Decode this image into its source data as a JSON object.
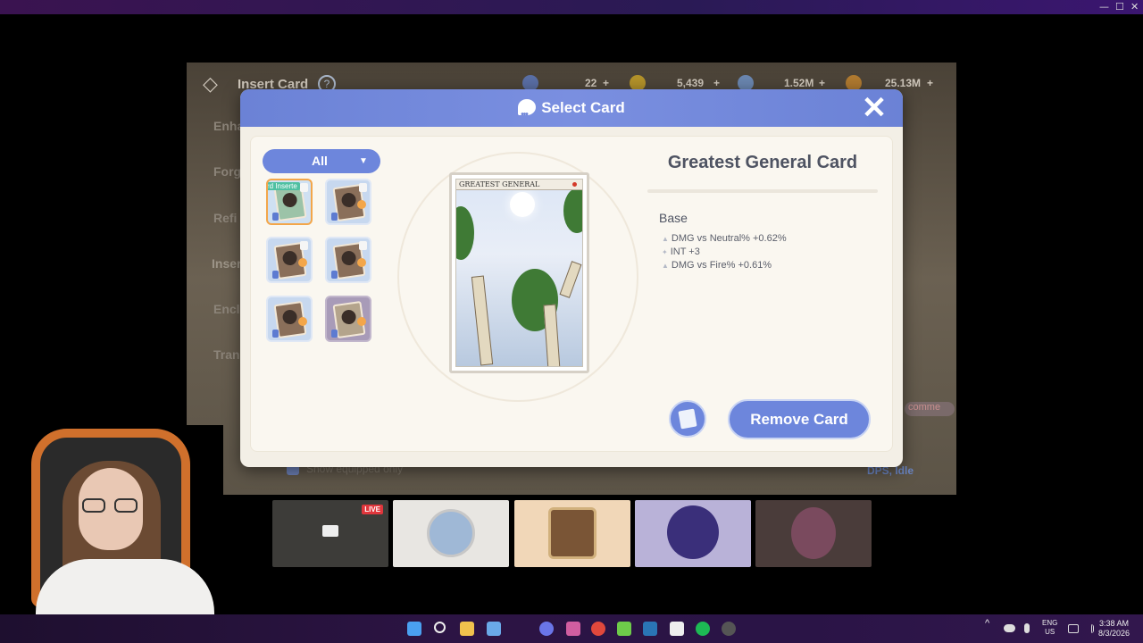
{
  "window_controls": {
    "minimize": "—",
    "maximize": "☐",
    "close": "✕"
  },
  "game": {
    "title": "Insert Card",
    "help": "?",
    "resources": [
      {
        "value": "22",
        "plus": "+",
        "color": "#5a6fa6"
      },
      {
        "value": "5,439",
        "plus": "+",
        "color": "#b3922a"
      },
      {
        "value": "1.52M",
        "plus": "+",
        "color": "#6a86b0"
      },
      {
        "value": "25.13M",
        "plus": "+",
        "color": "#b07a30"
      }
    ],
    "sidebar": [
      "Enha",
      "Forg",
      "Refi",
      "Insert",
      "Encl",
      "Tran"
    ],
    "show_equipped": "Show equipped only",
    "dps_label": "DPS, Idle",
    "comment_tag": "comme"
  },
  "modal": {
    "title": "Select Card",
    "close_label": "✕",
    "filter": {
      "selected": "All",
      "arrow": "▼"
    },
    "inserted_tag": "rd Inserte",
    "slots": [
      {
        "state": "inserted"
      },
      {
        "state": "normal"
      },
      {
        "state": "normal"
      },
      {
        "state": "normal"
      },
      {
        "state": "normal"
      },
      {
        "state": "dark"
      }
    ],
    "card_art_name": "GREATEST GENERAL",
    "card_title": "Greatest General Card",
    "base_label": "Base",
    "stats": [
      "DMG vs Neutral% +0.62%",
      "INT +3",
      "DMG vs Fire% +0.61%"
    ],
    "remove_button": "Remove Card"
  },
  "stream": {
    "live_badge": "LIVE"
  },
  "taskbar": {
    "lang_top": "ENG",
    "lang_bottom": "US",
    "time": "3:38 AM",
    "date": "8/3/2026",
    "tray_up": "^"
  }
}
